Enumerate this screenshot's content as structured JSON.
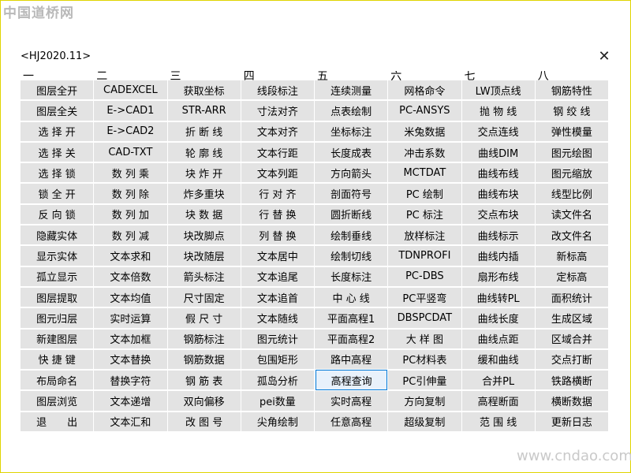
{
  "watermark_top": "中国道桥网",
  "watermark_bottom": "www.cndao.com",
  "dialog": {
    "title": "<HJ2020.11>",
    "close_symbol": "✕"
  },
  "columns": [
    {
      "header": "一",
      "items": [
        "图层全开",
        "图层全关",
        "选 择 开",
        "选 择 关",
        "选 择 锁",
        "锁 全 开",
        "反 向 锁",
        "隐藏实体",
        "显示实体",
        "孤立显示",
        "图层提取",
        "图元归层",
        "新建图层",
        "快 捷 键",
        "布局命名",
        "图层浏览",
        "退　　出"
      ]
    },
    {
      "header": "二",
      "items": [
        "CADEXCEL",
        "E->CAD1",
        "E->CAD2",
        "CAD-TXT",
        "数 列 乘",
        "数 列 除",
        "数 列 加",
        "数 列 减",
        "文本求和",
        "文本倍数",
        "文本均值",
        "实时运算",
        "文本加框",
        "文本替换",
        "替换字符",
        "文本递增",
        "文本汇和"
      ]
    },
    {
      "header": "三",
      "items": [
        "获取坐标",
        "STR-ARR",
        "折 断 线",
        "轮 廓 线",
        "块 炸 开",
        "炸多重块",
        "块 数 据",
        "块改脚点",
        "块改随层",
        "箭头标注",
        "尺寸固定",
        "假 尺 寸",
        "钢筋标注",
        "钢筋数据",
        "钢 筋 表",
        "双向偏移",
        "改 图 号"
      ]
    },
    {
      "header": "四",
      "items": [
        "线段标注",
        "寸法对齐",
        "文本对齐",
        "文本行距",
        "文本列距",
        "行 对 齐",
        "行 替 换",
        "列 替 换",
        "文本居中",
        "文本追尾",
        "文本追首",
        "文本随线",
        "图元统计",
        "包围矩形",
        "孤岛分析",
        "pei数量",
        "尖角绘制"
      ]
    },
    {
      "header": "五",
      "items": [
        "连续测量",
        "点表绘制",
        "坐标标注",
        "长度成表",
        "方向箭头",
        "剖面符号",
        "圆折断线",
        "绘制垂线",
        "绘制切线",
        "长度标注",
        "中 心 线",
        "平面高程1",
        "平面高程2",
        "路中高程",
        "高程查询",
        "实时高程",
        "任意高程"
      ]
    },
    {
      "header": "六",
      "items": [
        "网格命令",
        "PC-ANSYS",
        "米兔数据",
        "冲击系数",
        "MCTDAT",
        "PC 绘制",
        "PC 标注",
        "放样标注",
        "TDNPROFI",
        "PC-DBS",
        "PC平竖弯",
        "DBSPCDAT",
        "大 样 图",
        "PC材料表",
        "PC引伸量",
        "方向复制",
        "超级复制"
      ]
    },
    {
      "header": "七",
      "items": [
        "LW顶点线",
        "抛 物 线",
        "交点连线",
        "曲线DIM",
        "曲线布线",
        "曲线布块",
        "交点布块",
        "曲线标示",
        "曲线内插",
        "扇形布线",
        "曲线转PL",
        "曲线长度",
        "曲线点距",
        "缓和曲线",
        "合并PL",
        "高程断面",
        "范 围 线"
      ]
    },
    {
      "header": "八",
      "items": [
        "钢筋特性",
        "钢 绞 线",
        "弹性模量",
        "图元绘图",
        "图元缩放",
        "线型比例",
        "读文件名",
        "改文件名",
        "新标高",
        "定标高",
        "面积统计",
        "生成区域",
        "区域合并",
        "交点打断",
        "铁路横断",
        "横断数据",
        "更新日志"
      ]
    }
  ],
  "selected": "高程查询"
}
